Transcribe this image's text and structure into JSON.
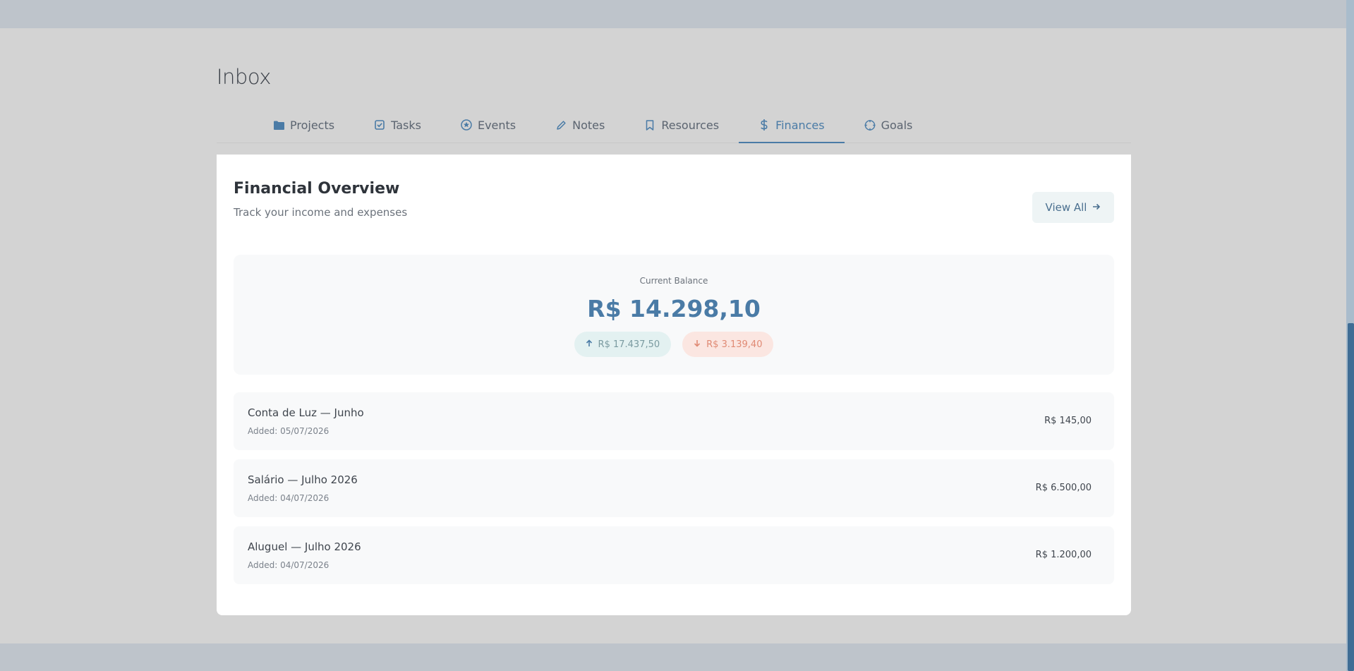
{
  "page": {
    "title": "Inbox"
  },
  "tabs": [
    {
      "label": "Projects",
      "icon": "folder-icon"
    },
    {
      "label": "Tasks",
      "icon": "checkbox-icon"
    },
    {
      "label": "Events",
      "icon": "star-circle-icon"
    },
    {
      "label": "Notes",
      "icon": "pencil-icon"
    },
    {
      "label": "Resources",
      "icon": "bookmark-icon"
    },
    {
      "label": "Finances",
      "icon": "dollar-icon",
      "active": true
    },
    {
      "label": "Goals",
      "icon": "target-icon"
    }
  ],
  "card": {
    "title": "Financial Overview",
    "subtitle": "Track your income and expenses",
    "view_all_label": "View All",
    "view_all_icon": "arrow-right-icon"
  },
  "balance": {
    "label": "Current Balance",
    "value": "R$ 14.298,10",
    "income": "R$ 17.437,50",
    "expense": "R$ 3.139,40",
    "income_icon": "arrow-up-icon",
    "expense_icon": "arrow-down-icon"
  },
  "transactions": [
    {
      "name": "Conta de Luz — Junho",
      "date": "Added: 05/07/2026",
      "amount": "R$ 145,00"
    },
    {
      "name": "Salário — Julho 2026",
      "date": "Added: 04/07/2026",
      "amount": "R$ 6.500,00"
    },
    {
      "name": "Aluguel — Julho 2026",
      "date": "Added: 04/07/2026",
      "amount": "R$ 1.200,00"
    }
  ],
  "colors": {
    "accent": "#4a7ba6",
    "background": "#d3d3d3",
    "bar": "#bec4cb",
    "income_bg": "#e3f1f1",
    "expense_bg": "#fbe6e1",
    "expense_text": "#e08a74"
  }
}
